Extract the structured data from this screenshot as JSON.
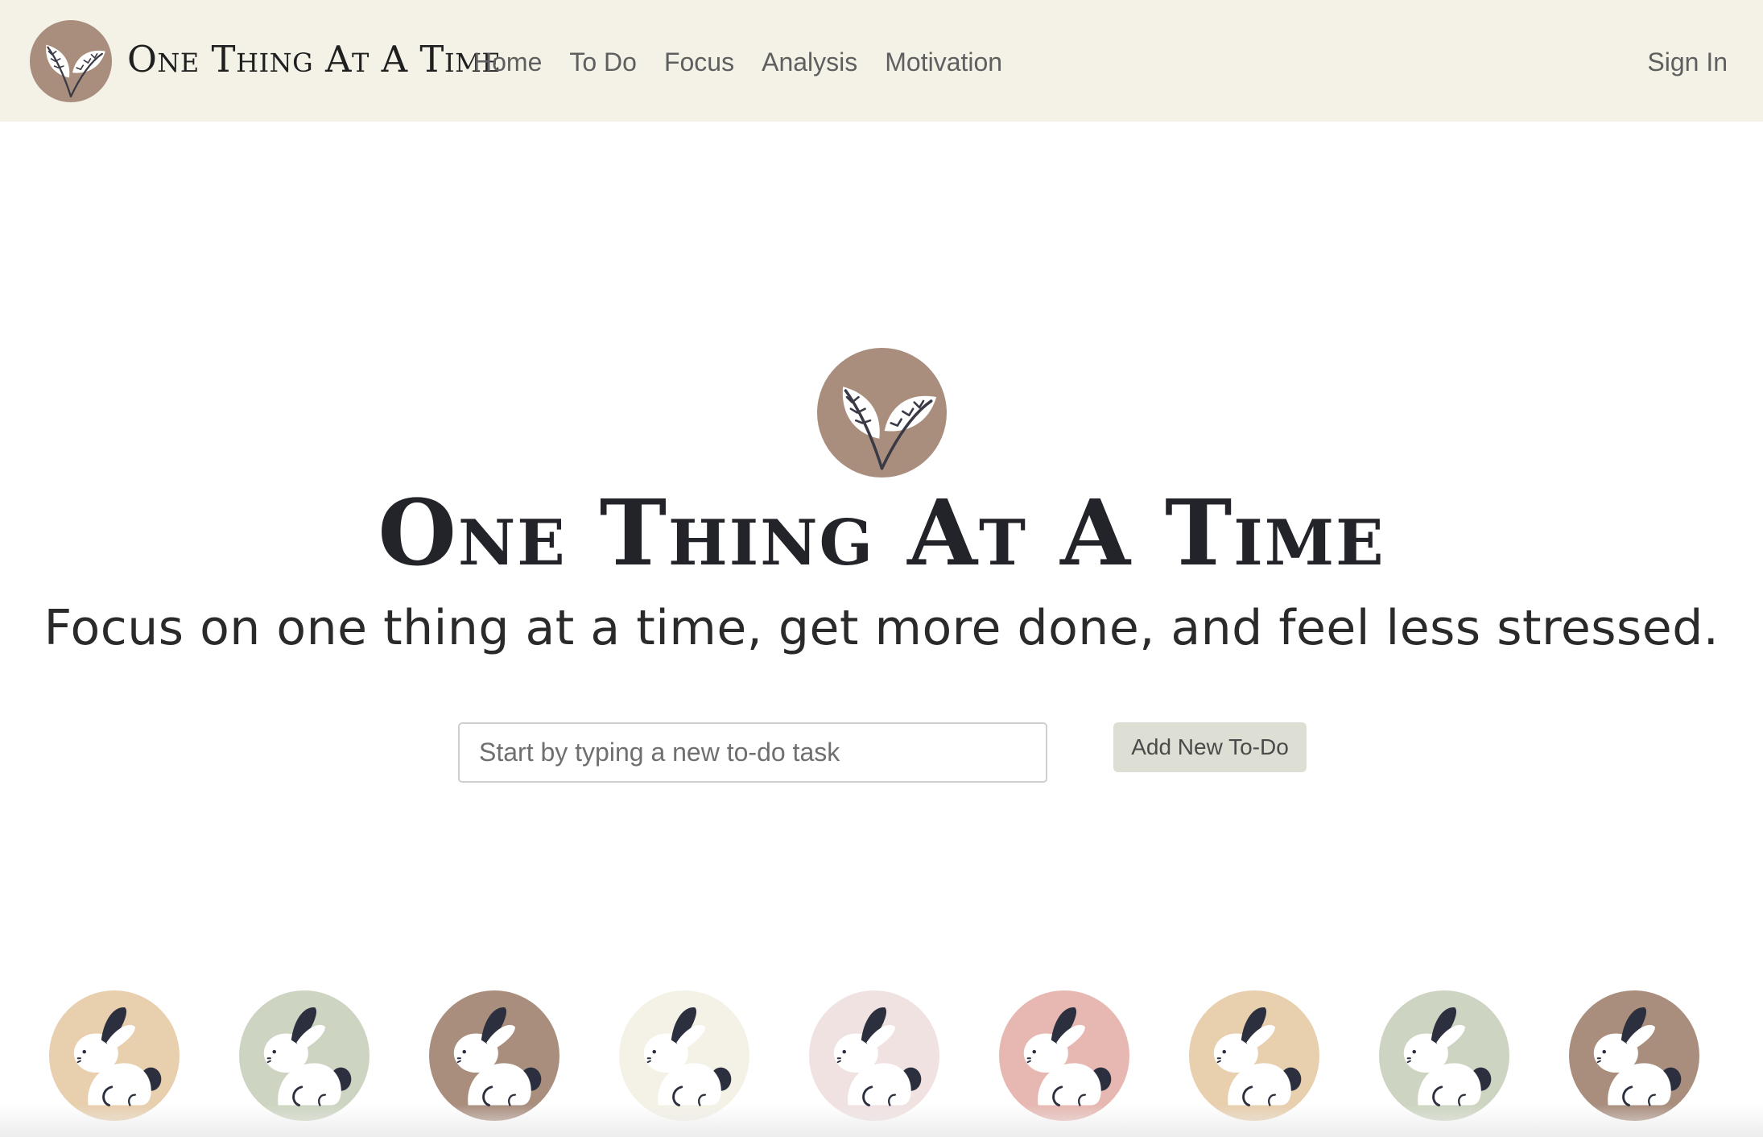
{
  "navbar": {
    "brand": "One Thing At A Time",
    "links": [
      "Home",
      "To Do",
      "Focus",
      "Analysis",
      "Motivation"
    ],
    "sign_in": "Sign In",
    "background": "#f4f2e7"
  },
  "hero": {
    "title": "One Thing At A Time",
    "subtitle": "Focus on one thing at a time, get more done, and feel less stressed.",
    "logo_icon": "leaf-icon",
    "logo_color": "#a98e7e"
  },
  "todo_form": {
    "input_placeholder": "Start by typing a new to-do task",
    "input_value": "",
    "add_button_label": "Add New To-Do"
  },
  "bunny_row": {
    "icon": "bunny-icon",
    "colors": [
      "#e8cfae",
      "#cdd5c2",
      "#a98e7e",
      "#f4f2e7",
      "#f1e2e2",
      "#e7b8b2",
      "#e8cfae",
      "#cdd5c2",
      "#a98e7e"
    ]
  }
}
